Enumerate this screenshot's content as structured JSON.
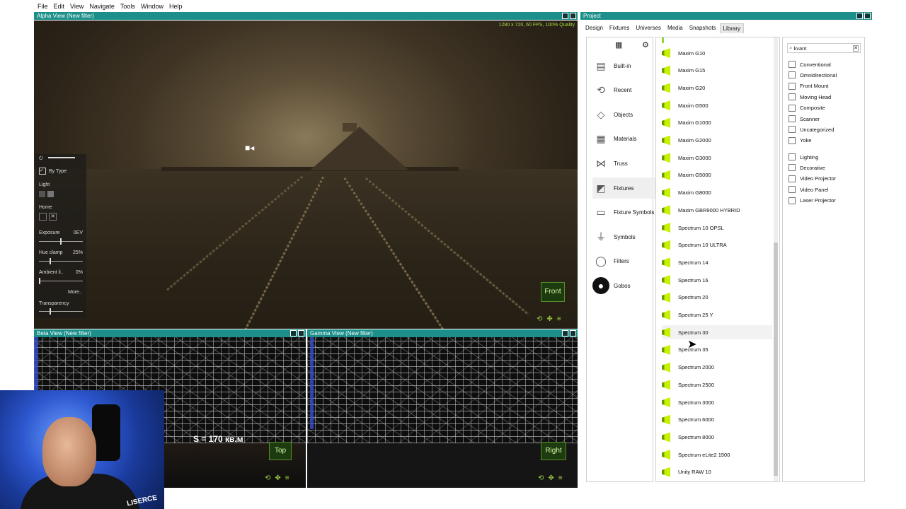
{
  "menu": [
    "File",
    "Edit",
    "View",
    "Navigate",
    "Tools",
    "Window",
    "Help"
  ],
  "alpha": {
    "title": "Alpha View  (New filter)",
    "stats": "1280 x 720, 60 FPS, 100% Quality",
    "view_button": "Front",
    "overlay": {
      "by_type": "By Type",
      "light": "Light",
      "home": "Home",
      "exposure_label": "Exposure",
      "exposure_value": "0EV",
      "hue_label": "Hue clamp",
      "hue_value": "25%",
      "ambient_label": "Ambient li..",
      "ambient_value": "0%",
      "more": "More..",
      "transparency_label": "Transparency",
      "exposure_level": 0.5,
      "hue_level": 0.25,
      "ambient_level": 0.0,
      "transparency_level": 0.25
    }
  },
  "beta": {
    "title": "Beta View  (New filter)",
    "view_button": "Top",
    "measure": "S = 170 кв.м"
  },
  "gamma": {
    "title": "Gamma View  (New filter)",
    "view_button": "Right"
  },
  "project": {
    "title": "Project",
    "tabs": [
      "Design",
      "Fixtures",
      "Universes",
      "Media",
      "Snapshots",
      "Library"
    ],
    "active_tab": "Library",
    "categories": [
      {
        "label": "Built-in",
        "icon": "building-icon"
      },
      {
        "label": "Recent",
        "icon": "history-icon"
      },
      {
        "label": "Objects",
        "icon": "cube-icon"
      },
      {
        "label": "Materials",
        "icon": "brick-icon"
      },
      {
        "label": "Truss",
        "icon": "truss-icon"
      },
      {
        "label": "Fixtures",
        "icon": "spotlight-icon"
      },
      {
        "label": "Fixture Symbols",
        "icon": "symbol-box-icon"
      },
      {
        "label": "Symbols",
        "icon": "ground-symbol-icon"
      },
      {
        "label": "Filters",
        "icon": "filter-ring-icon"
      },
      {
        "label": "Gobos",
        "icon": "gobo-icon"
      }
    ],
    "selected_category": "Fixtures",
    "fixtures": [
      "Maxim G10",
      "Maxim G15",
      "Maxim G20",
      "Maxim G500",
      "Maxim G1000",
      "Maxim G2000",
      "Maxim G3000",
      "Maxim G5000",
      "Maxim G8000",
      "Maxim GBR9000 HYBRID",
      "Spectrum 10 OPSL",
      "Spectrum 10 ULTRA",
      "Spectrum 14",
      "Spectrum 16",
      "Spectrum 20",
      "Spectrum 25 Y",
      "Spectrum 30",
      "Spectrum 35",
      "Spectrum 2000",
      "Spectrum 2500",
      "Spectrum 3000",
      "Spectrum 6000",
      "Spectrum 8000",
      "Spectrum eLite2 1500",
      "Unity RAW 10"
    ],
    "hovered_fixture": "Spectrum 30",
    "search": {
      "value": "kvant"
    },
    "filters_group1": [
      "Conventional",
      "Omnidirectional",
      "Front Mount",
      "Moving Head",
      "Composite",
      "Scanner",
      "Uncategorized",
      "Yoke"
    ],
    "filters_group2": [
      "Lighting",
      "Decorative",
      "Video Projector",
      "Video Panel",
      "Laser Projector"
    ]
  },
  "webcam": {
    "caption": "LISERCE"
  },
  "colors": {
    "title_bar": "#1c8f8a",
    "accent_green": "#9bd043",
    "fixture_icon": "#c8f000"
  }
}
